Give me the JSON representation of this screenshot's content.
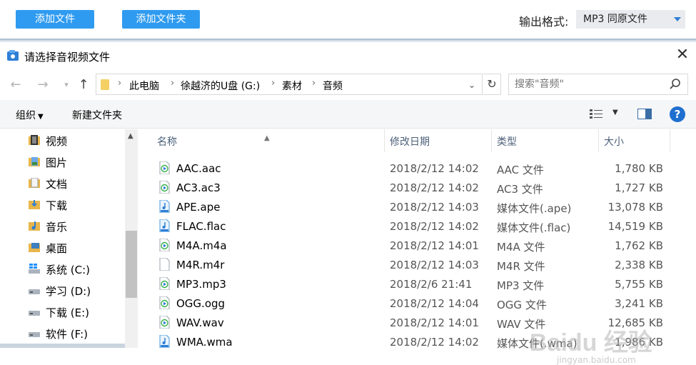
{
  "app_toolbar": {
    "add_file_label": "添加文件",
    "add_folder_label": "添加文件夹",
    "output_format_label": "输出格式:",
    "output_format_value": "MP3  同原文件"
  },
  "dialog": {
    "title": "请选择音视频文件",
    "breadcrumb": [
      "此电脑",
      "徐越济的U盘 (G:)",
      "素材",
      "音频"
    ],
    "search_placeholder": "搜索\"音频\"",
    "organize_label": "组织",
    "new_folder_label": "新建文件夹"
  },
  "nav_pane": {
    "items": [
      {
        "label": "视频",
        "icon": "video-folder-icon"
      },
      {
        "label": "图片",
        "icon": "pictures-folder-icon"
      },
      {
        "label": "文档",
        "icon": "documents-folder-icon"
      },
      {
        "label": "下载",
        "icon": "downloads-folder-icon"
      },
      {
        "label": "音乐",
        "icon": "music-folder-icon"
      },
      {
        "label": "桌面",
        "icon": "desktop-folder-icon"
      },
      {
        "label": "系统 (C:)",
        "icon": "windows-drive-icon"
      },
      {
        "label": "学习 (D:)",
        "icon": "drive-icon"
      },
      {
        "label": "下载 (E:)",
        "icon": "drive-icon"
      },
      {
        "label": "软件 (F:)",
        "icon": "drive-icon"
      }
    ]
  },
  "file_list": {
    "columns": [
      "名称",
      "修改日期",
      "类型",
      "大小"
    ],
    "rows": [
      {
        "name": "AAC.aac",
        "date": "2018/2/12 14:02",
        "type": "AAC 文件",
        "size": "1,780 KB",
        "icon": "media-play-icon"
      },
      {
        "name": "AC3.ac3",
        "date": "2018/2/12 14:02",
        "type": "AC3 文件",
        "size": "1,727 KB",
        "icon": "media-play-icon"
      },
      {
        "name": "APE.ape",
        "date": "2018/2/12 14:03",
        "type": "媒体文件(.ape)",
        "size": "13,078 KB",
        "icon": "audio-file-icon"
      },
      {
        "name": "FLAC.flac",
        "date": "2018/2/12 14:02",
        "type": "媒体文件(.flac)",
        "size": "14,519 KB",
        "icon": "audio-file-icon"
      },
      {
        "name": "M4A.m4a",
        "date": "2018/2/12 14:01",
        "type": "M4A 文件",
        "size": "1,762 KB",
        "icon": "media-play-icon"
      },
      {
        "name": "M4R.m4r",
        "date": "2018/2/12 14:03",
        "type": "M4R 文件",
        "size": "2,338 KB",
        "icon": "blank-file-icon"
      },
      {
        "name": "MP3.mp3",
        "date": "2018/2/6 21:41",
        "type": "MP3 文件",
        "size": "5,755 KB",
        "icon": "media-play-icon"
      },
      {
        "name": "OGG.ogg",
        "date": "2018/2/12 14:04",
        "type": "OGG 文件",
        "size": "3,241 KB",
        "icon": "media-play-icon"
      },
      {
        "name": "WAV.wav",
        "date": "2018/2/12 14:01",
        "type": "WAV 文件",
        "size": "12,685 KB",
        "icon": "media-play-icon"
      },
      {
        "name": "WMA.wma",
        "date": "2018/2/12 14:02",
        "type": "媒体文件(.wma)",
        "size": "1,986 KB",
        "icon": "audio-file-icon"
      }
    ]
  },
  "watermark": {
    "text": "Baidu 经验",
    "sub": "jingyan.baidu.com"
  },
  "colors": {
    "accent": "#2f9bf0",
    "link": "#4c607a",
    "help": "#1f6fd0"
  }
}
